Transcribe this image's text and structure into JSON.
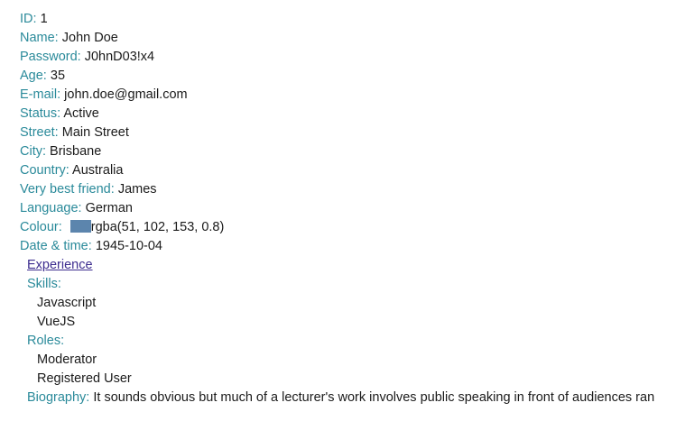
{
  "fields": [
    {
      "label": "ID:",
      "value": "1"
    },
    {
      "label": "Name:",
      "value": "John Doe"
    },
    {
      "label": "Password:",
      "value": "J0hnD03!x4"
    },
    {
      "label": "Age:",
      "value": "35"
    },
    {
      "label": "E-mail:",
      "value": "john.doe@gmail.com"
    },
    {
      "label": "Status:",
      "value": "Active"
    },
    {
      "label": "Street:",
      "value": "Main Street"
    },
    {
      "label": "City:",
      "value": "Brisbane"
    },
    {
      "label": "Country:",
      "value": "Australia"
    },
    {
      "label": "Very best friend:",
      "value": "James"
    },
    {
      "label": "Language:",
      "value": "German"
    }
  ],
  "colour": {
    "label": "Colour:",
    "value": "rgba(51, 102, 153, 0.8)",
    "swatch": "rgba(51, 102, 153, 0.8)"
  },
  "datetime": {
    "label": "Date & time:",
    "value": "1945-10-04"
  },
  "experience": {
    "label": "Experience"
  },
  "skills": {
    "label": "Skills:",
    "items": [
      "Javascript",
      "VueJS"
    ]
  },
  "roles": {
    "label": "Roles:",
    "items": [
      "Moderator",
      "Registered User"
    ]
  },
  "biography": {
    "label": "Biography:",
    "value": "It sounds obvious but much of a lecturer's work involves public speaking in front of audiences ran"
  },
  "colors": {
    "label": "#2a8a9a",
    "link": "#3d2d8f",
    "text": "#1a1a1a"
  }
}
